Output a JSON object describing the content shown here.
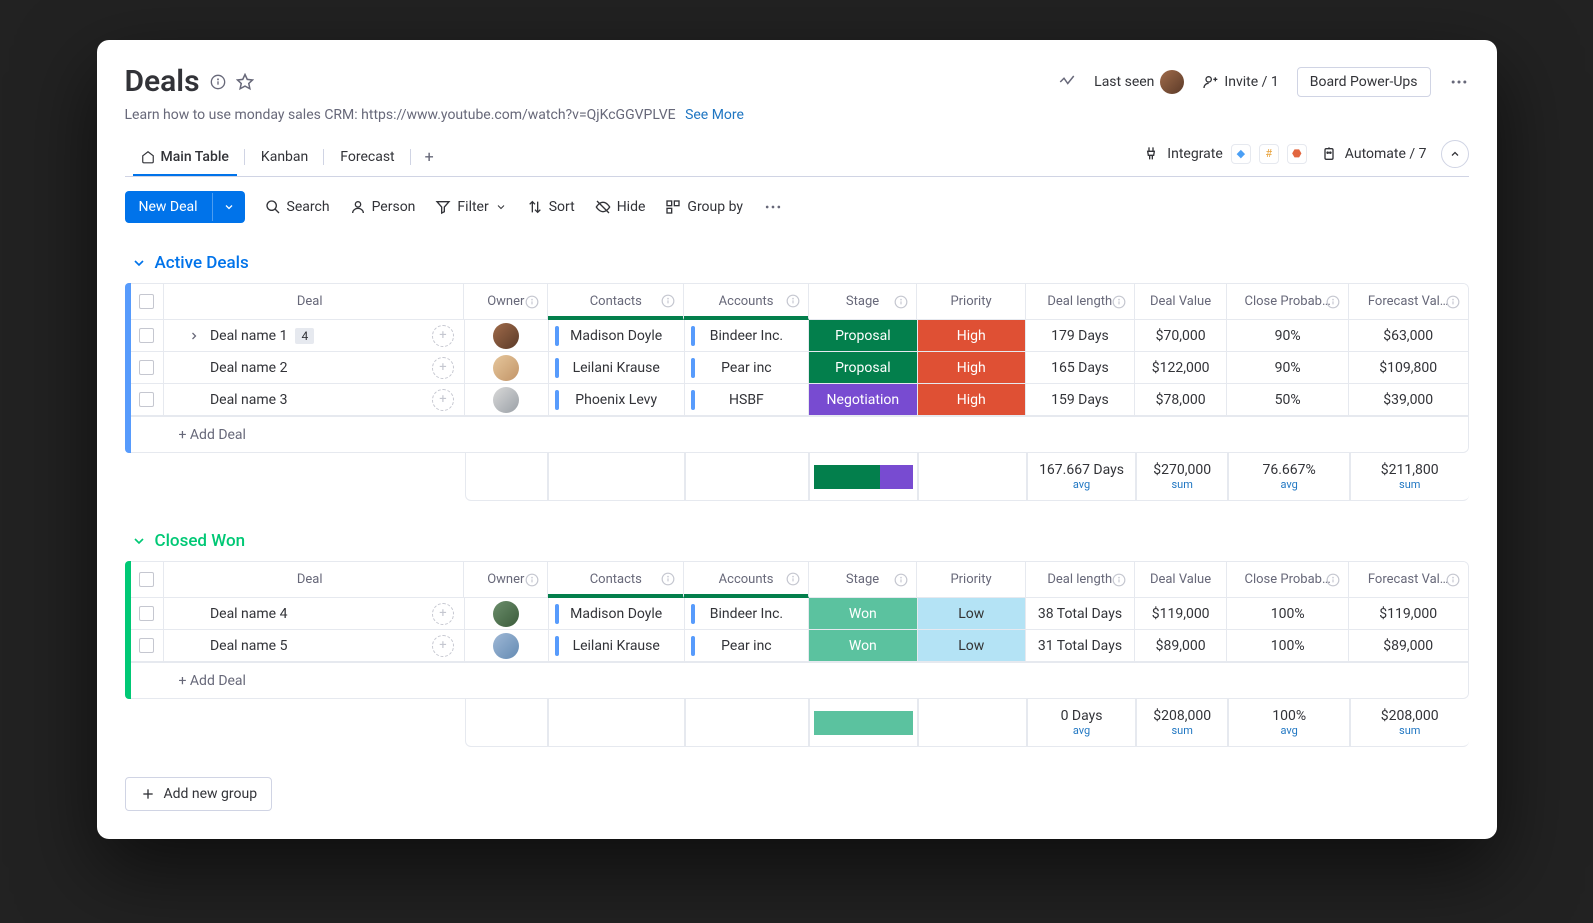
{
  "header": {
    "title": "Deals",
    "last_seen": "Last seen",
    "invite": "Invite / 1",
    "powerups": "Board Power-Ups",
    "subtitle": "Learn how to use monday sales CRM: https://www.youtube.com/watch?v=QjKcGGVPLVE",
    "see_more": "See More"
  },
  "tabs": {
    "main": "Main Table",
    "kanban": "Kanban",
    "forecast": "Forecast",
    "integrate": "Integrate",
    "automate": "Automate / 7"
  },
  "toolbar": {
    "new_deal": "New Deal",
    "search": "Search",
    "person": "Person",
    "filter": "Filter",
    "sort": "Sort",
    "hide": "Hide",
    "group_by": "Group by"
  },
  "columns": {
    "deal": "Deal",
    "owner": "Owner",
    "contacts": "Contacts",
    "accounts": "Accounts",
    "stage": "Stage",
    "priority": "Priority",
    "length": "Deal length",
    "value": "Deal Value",
    "prob": "Close Probab…",
    "forecast": "Forecast Val…"
  },
  "add_deal": "+ Add Deal",
  "add_group": "Add new group",
  "groups": [
    {
      "name": "Active Deals",
      "color": "blue",
      "rows": [
        {
          "deal": "Deal name 1",
          "badge": "4",
          "expand": true,
          "avatar": "a",
          "contact": "Madison Doyle",
          "account": "Bindeer Inc.",
          "stage": "Proposal",
          "stage_cls": "s-proposal",
          "priority": "High",
          "pr_cls": "pr-high",
          "length": "179 Days",
          "value": "$70,000",
          "prob": "90%",
          "forecast": "$63,000"
        },
        {
          "deal": "Deal name 2",
          "avatar": "b",
          "contact": "Leilani Krause",
          "account": "Pear inc",
          "stage": "Proposal",
          "stage_cls": "s-proposal",
          "priority": "High",
          "pr_cls": "pr-high",
          "length": "165 Days",
          "value": "$122,000",
          "prob": "90%",
          "forecast": "$109,800"
        },
        {
          "deal": "Deal name 3",
          "avatar": "c",
          "contact": "Phoenix Levy",
          "account": "HSBF",
          "stage": "Negotiation",
          "stage_cls": "s-neg",
          "priority": "High",
          "pr_cls": "pr-high",
          "length": "159 Days",
          "value": "$78,000",
          "prob": "50%",
          "forecast": "$39,000"
        }
      ],
      "summary": {
        "stage_split": true,
        "length": "167.667 Days",
        "length_sub": "avg",
        "value": "$270,000",
        "value_sub": "sum",
        "prob": "76.667%",
        "prob_sub": "avg",
        "forecast": "$211,800",
        "forecast_sub": "sum"
      }
    },
    {
      "name": "Closed Won",
      "color": "green",
      "rows": [
        {
          "deal": "Deal name 4",
          "avatar": "d",
          "contact": "Madison Doyle",
          "account": "Bindeer Inc.",
          "stage": "Won",
          "stage_cls": "stage-won",
          "priority": "Low",
          "pr_cls": "pr-low",
          "length": "38 Total Days",
          "value": "$119,000",
          "prob": "100%",
          "forecast": "$119,000"
        },
        {
          "deal": "Deal name 5",
          "avatar": "e",
          "contact": "Leilani Krause",
          "account": "Pear inc",
          "stage": "Won",
          "stage_cls": "stage-won",
          "priority": "Low",
          "pr_cls": "pr-low",
          "length": "31 Total Days",
          "value": "$89,000",
          "prob": "100%",
          "forecast": "$89,000"
        }
      ],
      "summary": {
        "stage_won": true,
        "length": "0 Days",
        "length_sub": "avg",
        "value": "$208,000",
        "value_sub": "sum",
        "prob": "100%",
        "prob_sub": "avg",
        "forecast": "$208,000",
        "forecast_sub": "sum"
      }
    }
  ]
}
